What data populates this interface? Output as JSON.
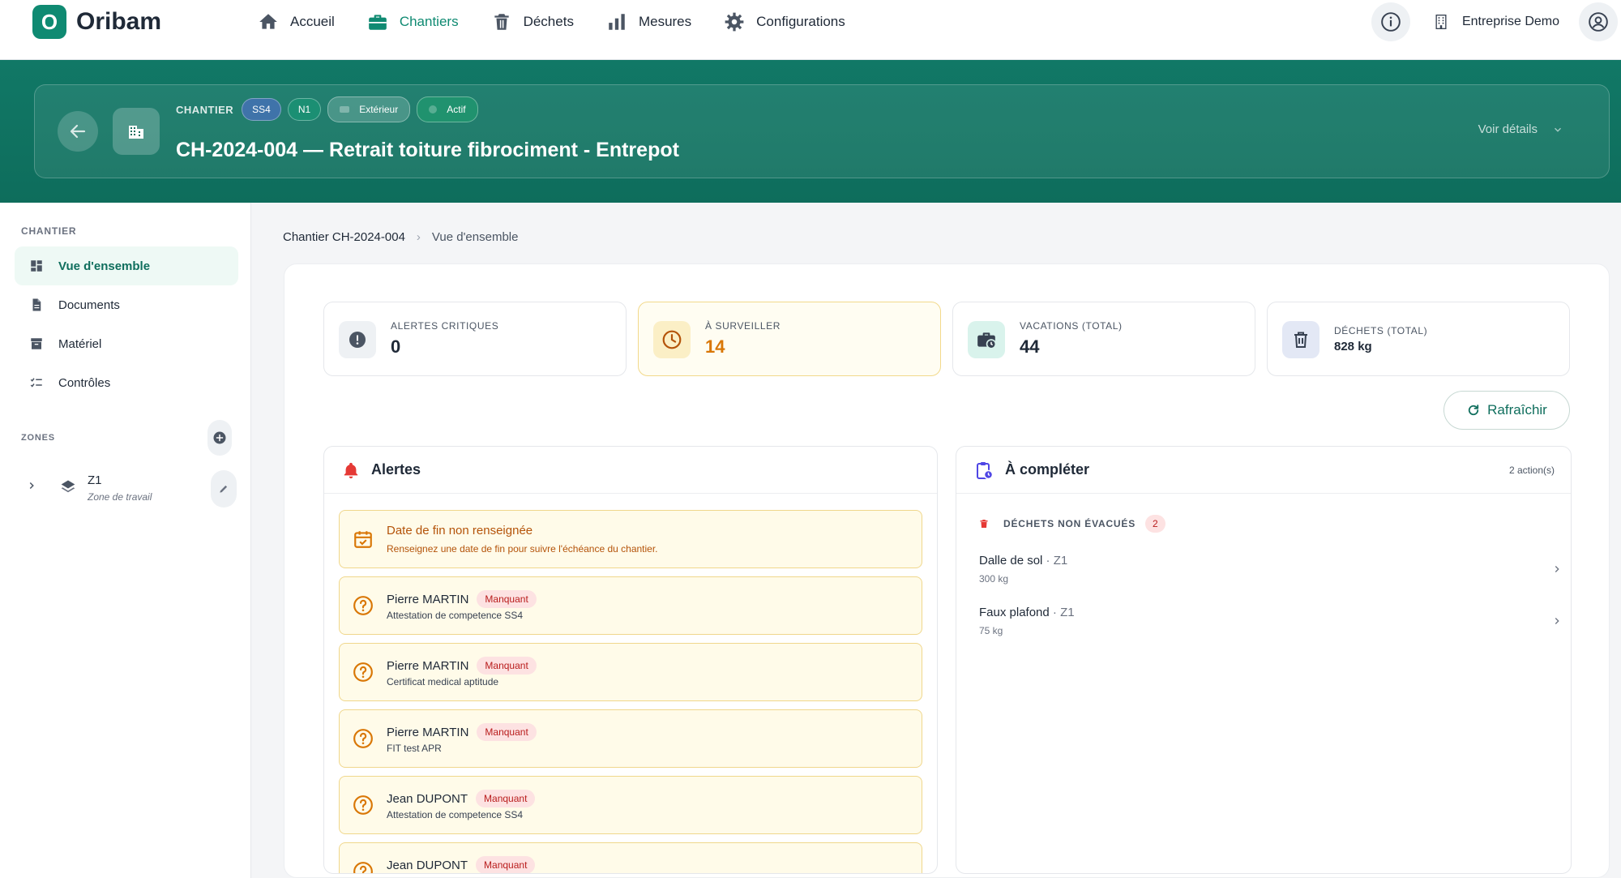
{
  "brand": {
    "logo_letter": "O",
    "name": "Oribam",
    "accent": "#0f8a72"
  },
  "nav": {
    "items": [
      {
        "label": "Accueil",
        "icon": "home-icon"
      },
      {
        "label": "Chantiers",
        "icon": "briefcase-icon",
        "active": true
      },
      {
        "label": "Déchets",
        "icon": "trash-icon"
      },
      {
        "label": "Mesures",
        "icon": "bar-chart-icon"
      },
      {
        "label": "Configurations",
        "icon": "gear-icon"
      }
    ],
    "company": "Entreprise Demo"
  },
  "hero": {
    "label": "CHANTIER",
    "tags": [
      "SS4",
      "N1"
    ],
    "location_tag": "Extérieur",
    "status_tag": "Actif",
    "title": "CH-2024-004 — Retrait toiture fibrociment - Entrepot",
    "details_label": "Voir détails"
  },
  "sidebar": {
    "section_chantier": "CHANTIER",
    "items": [
      {
        "label": "Vue d'ensemble",
        "icon": "dashboard-icon",
        "active": true
      },
      {
        "label": "Documents",
        "icon": "document-icon"
      },
      {
        "label": "Matériel",
        "icon": "archive-icon"
      },
      {
        "label": "Contrôles",
        "icon": "checklist-icon"
      }
    ],
    "section_zones": "ZONES",
    "zones": [
      {
        "name": "Z1",
        "subtitle": "Zone de travail"
      }
    ]
  },
  "breadcrumb": {
    "parent": "Chantier CH-2024-004",
    "current": "Vue d'ensemble"
  },
  "stats": [
    {
      "label": "ALERTES CRITIQUES",
      "value": "0"
    },
    {
      "label": "À SURVEILLER",
      "value": "14"
    },
    {
      "label": "VACATIONS (TOTAL)",
      "value": "44"
    },
    {
      "label": "DÉCHETS (TOTAL)",
      "value": "828 kg"
    }
  ],
  "refresh_label": "Rafraîchir",
  "alerts_card": {
    "title": "Alertes",
    "items": [
      {
        "title": "Date de fin non renseignée",
        "subtitle": "Renseignez une date de fin pour suivre l'échéance du chantier."
      },
      {
        "title": "Pierre MARTIN",
        "badge": "Manquant",
        "subtitle": "Attestation de competence SS4"
      },
      {
        "title": "Pierre MARTIN",
        "badge": "Manquant",
        "subtitle": "Certificat medical aptitude"
      },
      {
        "title": "Pierre MARTIN",
        "badge": "Manquant",
        "subtitle": "FIT test APR"
      },
      {
        "title": "Jean DUPONT",
        "badge": "Manquant",
        "subtitle": "Attestation de competence SS4"
      },
      {
        "title": "Jean DUPONT",
        "badge": "Manquant",
        "subtitle": ""
      }
    ]
  },
  "todo_card": {
    "title": "À compléter",
    "count": "2 action(s)",
    "section": "DÉCHETS NON ÉVACUÉS",
    "section_count": "2",
    "items": [
      {
        "name": "Dalle de sol",
        "zone": " · Z1",
        "weight": "300 kg"
      },
      {
        "name": "Faux plafond",
        "zone": " · Z1",
        "weight": "75 kg"
      }
    ]
  }
}
